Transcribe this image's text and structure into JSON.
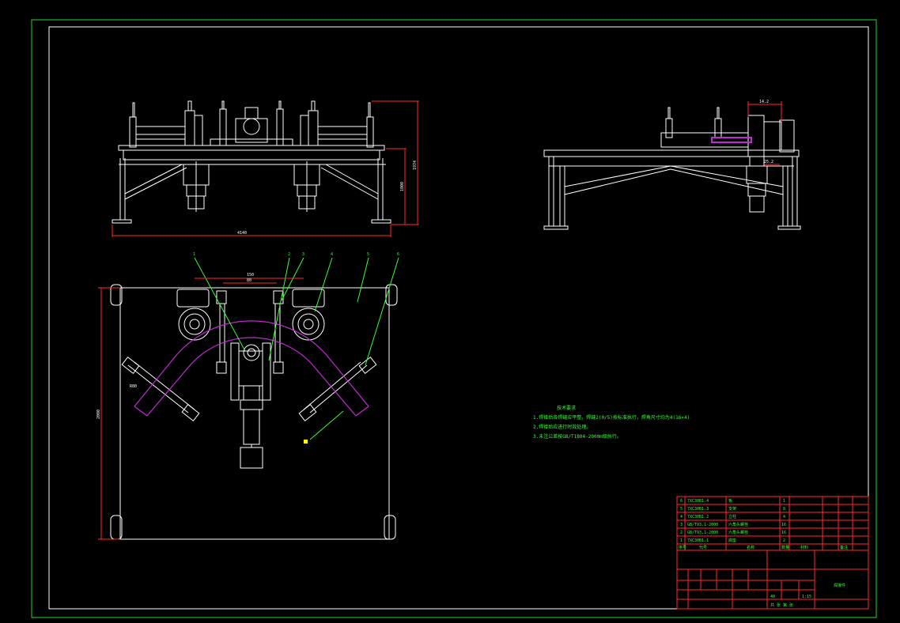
{
  "colors": {
    "background": "#000000",
    "frame": "#2ad62a",
    "linework": "#ffffff",
    "text": "#37ff3a",
    "title_block": "#ff2a2a",
    "arc": "#c22ad6",
    "leader": "#36ff36",
    "highlight": "#ffff00"
  },
  "notes": {
    "title": "技术要求",
    "items": [
      "1.焊接后各焊缝应平整，焊缝2(0/5)按标准执行，焊角尺寸均为4(16×4)",
      "2.焊接后应进行时效处理。",
      "3.未注公差按GB/T1804-2000m级执行。"
    ]
  },
  "dimensions": {
    "front_width": "4140",
    "front_height_1": "1974",
    "front_height_2": "1000",
    "plan_top_1": "150",
    "plan_top_2": "80",
    "plan_height": "2000",
    "plan_radius": "R80",
    "side_top": "14.2",
    "side_mid": "25.2"
  },
  "balloons": [
    "1",
    "2",
    "3",
    "4",
    "5",
    "6"
  ],
  "title_block": {
    "parts": [
      {
        "no": "6",
        "code": "7XC30B1.4",
        "name": "板"
      },
      {
        "no": "5",
        "code": "7XC30B1.3",
        "name": "支架"
      },
      {
        "no": "4",
        "code": "7XC30B1.2",
        "name": "立柱"
      },
      {
        "no": "3",
        "code": "GB/T93.1-2000",
        "name": "六角头螺栓"
      },
      {
        "no": "2",
        "code": "GB/T93.1-2000",
        "name": "六角头螺栓"
      },
      {
        "no": "1",
        "code": "7XC30B1.1",
        "name": "底座"
      }
    ],
    "qty": [
      "1",
      "8",
      "4",
      "16",
      "16",
      "2"
    ],
    "head_labels": [
      "序号",
      "代号",
      "名称",
      "数量",
      "材料",
      "备注"
    ],
    "drawing_title": "焊接件",
    "scale": "1:15",
    "weight": "40",
    "sheet_labels": "共 张 第 张"
  }
}
